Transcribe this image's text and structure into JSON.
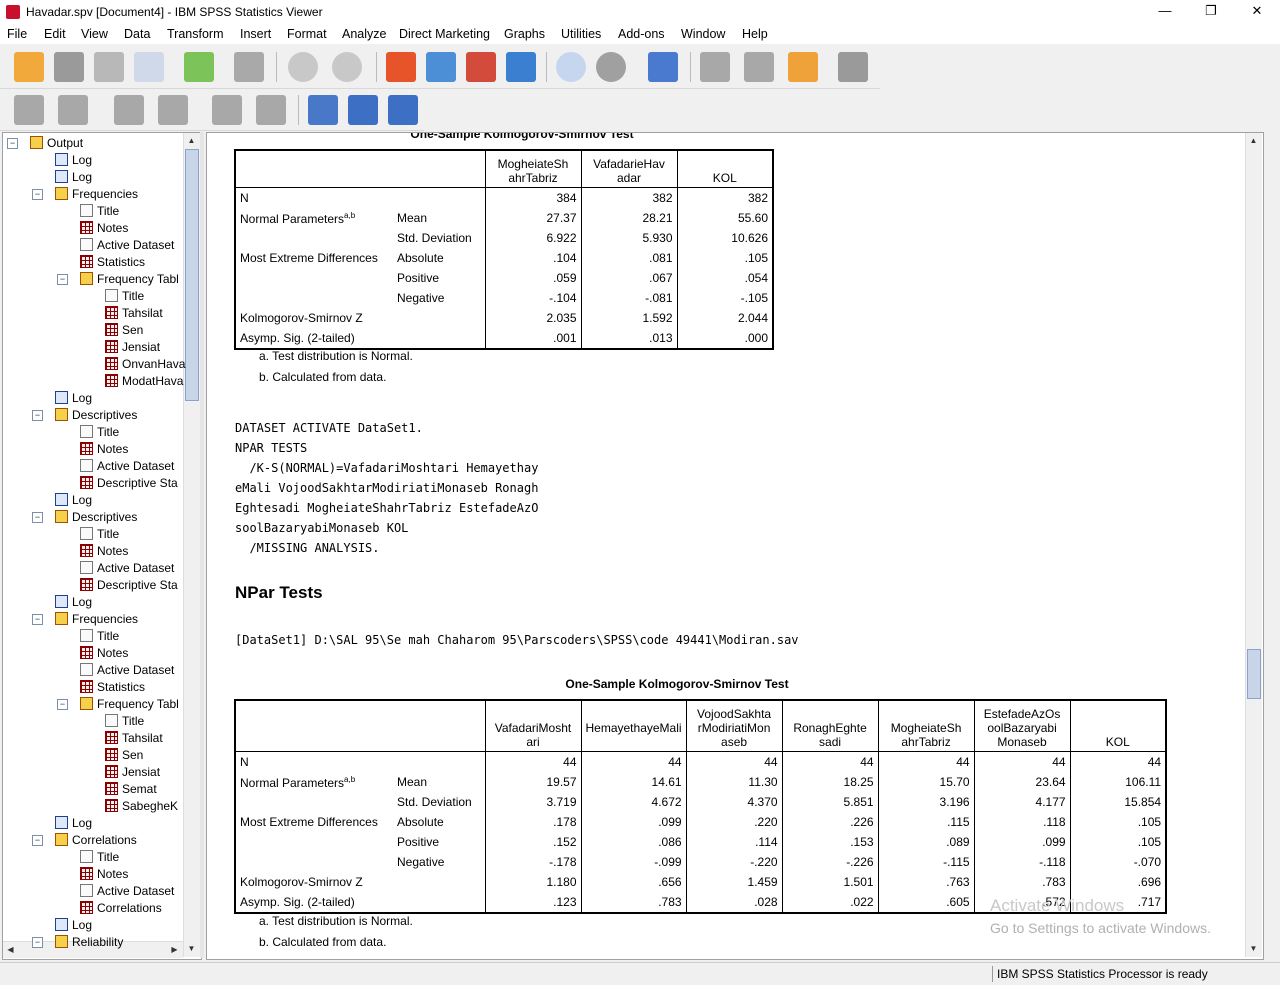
{
  "window": {
    "title": "Havadar.spv [Document4] - IBM SPSS Statistics Viewer",
    "minimize": "—",
    "restore": "❐",
    "close": "✕"
  },
  "menu": [
    "File",
    "Edit",
    "View",
    "Data",
    "Transform",
    "Insert",
    "Format",
    "Analyze",
    "Direct Marketing",
    "Graphs",
    "Utilities",
    "Add-ons",
    "Window",
    "Help"
  ],
  "nav": [
    {
      "label": "Output",
      "icon": "book",
      "level": 0,
      "exp": "−"
    },
    {
      "label": "Log",
      "icon": "log",
      "level": 1
    },
    {
      "label": "Log",
      "icon": "log",
      "level": 1
    },
    {
      "label": "Frequencies",
      "icon": "book",
      "level": 1,
      "exp": "−"
    },
    {
      "label": "Title",
      "icon": "doc",
      "level": 2
    },
    {
      "label": "Notes",
      "icon": "tbl",
      "level": 2
    },
    {
      "label": "Active Dataset",
      "icon": "doc",
      "level": 2
    },
    {
      "label": "Statistics",
      "icon": "tbl",
      "level": 2
    },
    {
      "label": "Frequency Tabl",
      "icon": "book",
      "level": 2,
      "exp": "−"
    },
    {
      "label": "Title",
      "icon": "doc",
      "level": 3
    },
    {
      "label": "Tahsilat",
      "icon": "tbl",
      "level": 3
    },
    {
      "label": "Sen",
      "icon": "tbl",
      "level": 3
    },
    {
      "label": "Jensiat",
      "icon": "tbl",
      "level": 3
    },
    {
      "label": "OnvanHava",
      "icon": "tbl",
      "level": 3
    },
    {
      "label": "ModatHava",
      "icon": "tbl",
      "level": 3
    },
    {
      "label": "Log",
      "icon": "log",
      "level": 1
    },
    {
      "label": "Descriptives",
      "icon": "book",
      "level": 1,
      "exp": "−"
    },
    {
      "label": "Title",
      "icon": "doc",
      "level": 2
    },
    {
      "label": "Notes",
      "icon": "tbl",
      "level": 2
    },
    {
      "label": "Active Dataset",
      "icon": "doc",
      "level": 2
    },
    {
      "label": "Descriptive Sta",
      "icon": "tbl",
      "level": 2
    },
    {
      "label": "Log",
      "icon": "log",
      "level": 1
    },
    {
      "label": "Descriptives",
      "icon": "book",
      "level": 1,
      "exp": "−"
    },
    {
      "label": "Title",
      "icon": "doc",
      "level": 2
    },
    {
      "label": "Notes",
      "icon": "tbl",
      "level": 2
    },
    {
      "label": "Active Dataset",
      "icon": "doc",
      "level": 2
    },
    {
      "label": "Descriptive Sta",
      "icon": "tbl",
      "level": 2
    },
    {
      "label": "Log",
      "icon": "log",
      "level": 1
    },
    {
      "label": "Frequencies",
      "icon": "book",
      "level": 1,
      "exp": "−"
    },
    {
      "label": "Title",
      "icon": "doc",
      "level": 2
    },
    {
      "label": "Notes",
      "icon": "tbl",
      "level": 2
    },
    {
      "label": "Active Dataset",
      "icon": "doc",
      "level": 2
    },
    {
      "label": "Statistics",
      "icon": "tbl",
      "level": 2
    },
    {
      "label": "Frequency Tabl",
      "icon": "book",
      "level": 2,
      "exp": "−"
    },
    {
      "label": "Title",
      "icon": "doc",
      "level": 3
    },
    {
      "label": "Tahsilat",
      "icon": "tbl",
      "level": 3
    },
    {
      "label": "Sen",
      "icon": "tbl",
      "level": 3
    },
    {
      "label": "Jensiat",
      "icon": "tbl",
      "level": 3
    },
    {
      "label": "Semat",
      "icon": "tbl",
      "level": 3
    },
    {
      "label": "SabegheK",
      "icon": "tbl",
      "level": 3
    },
    {
      "label": "Log",
      "icon": "log",
      "level": 1
    },
    {
      "label": "Correlations",
      "icon": "book",
      "level": 1,
      "exp": "−"
    },
    {
      "label": "Title",
      "icon": "doc",
      "level": 2
    },
    {
      "label": "Notes",
      "icon": "tbl",
      "level": 2
    },
    {
      "label": "Active Dataset",
      "icon": "doc",
      "level": 2
    },
    {
      "label": "Correlations",
      "icon": "tbl",
      "level": 2
    },
    {
      "label": "Log",
      "icon": "log",
      "level": 1
    },
    {
      "label": "Reliability",
      "icon": "book",
      "level": 1,
      "exp": "−"
    }
  ],
  "table1": {
    "title": "One-Sample Kolmogorov-Smirnov Test",
    "columns": [
      [
        "MogheiateSh",
        "ahrTabriz"
      ],
      [
        "VafadarieHav",
        "adar"
      ],
      [
        "",
        "KOL"
      ]
    ],
    "rows": [
      [
        "N",
        "",
        [
          "384",
          "382",
          "382"
        ]
      ],
      [
        "Normal Parameters",
        "Mean",
        [
          "27.37",
          "28.21",
          "55.60"
        ]
      ],
      [
        "",
        "Std. Deviation",
        [
          "6.922",
          "5.930",
          "10.626"
        ]
      ],
      [
        "Most Extreme Differences",
        "Absolute",
        [
          "​.104",
          ".081",
          ".105"
        ]
      ],
      [
        "",
        "Positive",
        [
          ".059",
          ".067",
          ".054"
        ]
      ],
      [
        "",
        "Negative",
        [
          "-.104",
          "-.081",
          "-.105"
        ]
      ],
      [
        "Kolmogorov-Smirnov Z",
        "",
        [
          "2.035",
          "1.592",
          "2.044"
        ]
      ],
      [
        "Asymp. Sig. (2-tailed)",
        "",
        [
          ".001",
          ".013",
          ".000"
        ]
      ]
    ],
    "superscript": "a,b",
    "footnotes": [
      "a. Test distribution is Normal.",
      "b. Calculated from data."
    ]
  },
  "syntax": "DATASET ACTIVATE DataSet1.\nNPAR TESTS\n  /K-S(NORMAL)=VafadariMoshtari Hemayethay\neMali VojoodSakhtarModiriatiMonaseb Ronagh\nEghtesadi MogheiateShahrTabriz EstefadeAzO\nsoolBazaryabiMonaseb KOL\n  /MISSING ANALYSIS.",
  "heading": "NPar Tests",
  "dataset_line": "[DataSet1] D:\\SAL 95\\Se mah Chaharom 95\\Parscoders\\SPSS\\code 49441\\Modiran.sav",
  "table2": {
    "title": "One-Sample Kolmogorov-Smirnov Test",
    "columns": [
      [
        "",
        "VafadariMosht",
        "ari"
      ],
      [
        "",
        "HemayethayeMali",
        ""
      ],
      [
        "VojoodSakhta",
        "rModiriatiMon",
        "aseb"
      ],
      [
        "",
        "RonaghEghte",
        "sadi"
      ],
      [
        "",
        "MogheiateSh",
        "ahrTabriz"
      ],
      [
        "EstefadeAzOs",
        "oolBazaryabi",
        "Monaseb"
      ],
      [
        "",
        "",
        "KOL"
      ]
    ],
    "rows": [
      [
        "N",
        "",
        [
          "44",
          "44",
          "44",
          "44",
          "44",
          "44",
          "44"
        ]
      ],
      [
        "Normal Parameters",
        "Mean",
        [
          "19.57",
          "14.61",
          "11.30",
          "18.25",
          "15.70",
          "23.64",
          "106.11"
        ]
      ],
      [
        "",
        "Std. Deviation",
        [
          "3.719",
          "4.672",
          "4.370",
          "5.851",
          "3.196",
          "4.177",
          "15.854"
        ]
      ],
      [
        "Most Extreme Differences",
        "Absolute",
        [
          ".178",
          ".099",
          ".220",
          ".226",
          ".115",
          ".118",
          ".105"
        ]
      ],
      [
        "",
        "Positive",
        [
          ".152",
          ".086",
          ".114",
          ".153",
          ".089",
          ".099",
          ".105"
        ]
      ],
      [
        "",
        "Negative",
        [
          "-.178",
          "-.099",
          "-.220",
          "-.226",
          "-.115",
          "-.118",
          "-.070"
        ]
      ],
      [
        "Kolmogorov-Smirnov Z",
        "",
        [
          "1.180",
          ".656",
          "1.459",
          "1.501",
          ".763",
          ".783",
          ".696"
        ]
      ],
      [
        "Asymp. Sig. (2-tailed)",
        "",
        [
          ".123",
          ".783",
          ".028",
          ".022",
          ".605",
          ".572",
          ".717"
        ]
      ]
    ],
    "superscript": "a,b",
    "footnotes": [
      "a. Test distribution is Normal.",
      "b. Calculated from data."
    ]
  },
  "watermark": {
    "line1": "Activate Windows",
    "line2": "Go to Settings to activate Windows."
  },
  "status": "IBM SPSS Statistics Processor is ready"
}
